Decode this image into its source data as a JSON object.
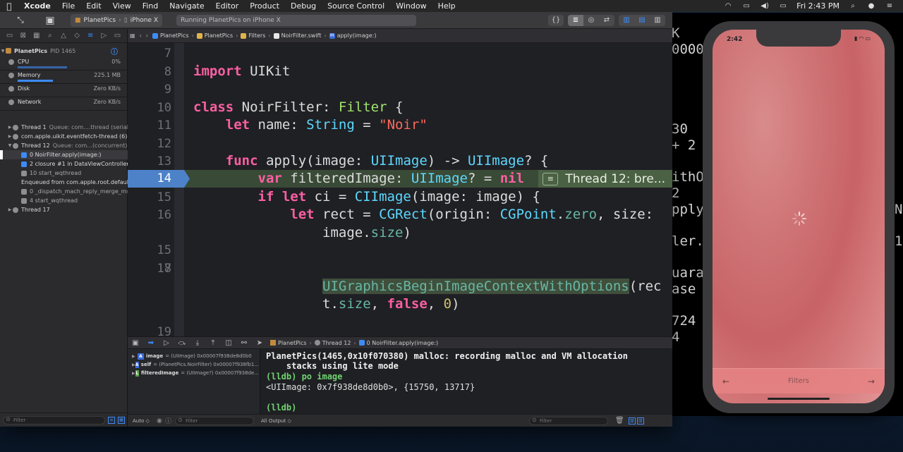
{
  "menubar": {
    "app": "Xcode",
    "items": [
      "File",
      "Edit",
      "View",
      "Find",
      "Navigate",
      "Editor",
      "Product",
      "Debug",
      "Source Control",
      "Window",
      "Help"
    ],
    "clock": "Fri 2:43 PM"
  },
  "toolbar": {
    "scheme": "PlanetPics",
    "destination": "iPhone X",
    "activity": "Running PlanetPics on iPhone X",
    "editor_mode_icon": "{}"
  },
  "navigator": {
    "process": "PlanetPics",
    "pid": "PID 1465",
    "gauges": [
      {
        "label": "CPU",
        "value": "0%"
      },
      {
        "label": "Memory",
        "value": "225.1 MB"
      },
      {
        "label": "Disk",
        "value": "Zero KB/s"
      },
      {
        "label": "Network",
        "value": "Zero KB/s"
      }
    ],
    "threads": [
      {
        "label": "Thread 1",
        "detail": "Queue: com....thread (serial)"
      },
      {
        "label": "com.apple.uikit.eventfetch-thread (6)",
        "detail": ""
      },
      {
        "label": "Thread 12",
        "detail": "Queue: com...(concurrent)"
      },
      {
        "label": "0 NoirFilter.apply(image:)",
        "detail": ""
      },
      {
        "label": "2 closure #1 in DataViewController...",
        "detail": ""
      },
      {
        "label": "10 start_wqthread",
        "detail": ""
      },
      {
        "label": "Enqueued from com.apple.root.default...",
        "detail": ""
      },
      {
        "label": "0 _dispatch_mach_reply_merge_msg",
        "detail": ""
      },
      {
        "label": "4 start_wqthread",
        "detail": ""
      },
      {
        "label": "Thread 17",
        "detail": ""
      }
    ],
    "filter_placeholder": "Filter"
  },
  "jumpbar": {
    "items": [
      "PlanetPics",
      "PlanetPics",
      "Filters",
      "NoirFilter.swift",
      "apply(image:)"
    ]
  },
  "editor": {
    "line_numbers": [
      "7",
      "8",
      "9",
      "10",
      "11",
      "12",
      "13",
      "14",
      "15",
      "16",
      "17",
      "18",
      "19"
    ],
    "current_line": "14",
    "breakpoint_label": "Thread 12: bre..."
  },
  "debugbar": {
    "crumbs": [
      "PlanetPics",
      "Thread 12",
      "0 NoirFilter.apply(image:)"
    ]
  },
  "variables": [
    {
      "badge": "A",
      "name": "image",
      "value": "= (UIImage) 0x00007f938de8d0b0"
    },
    {
      "badge": "A",
      "name": "self",
      "value": "= (PlanetPics.NoirFilter) 0x00007f938fb1..."
    },
    {
      "badge": "L",
      "name": "filteredImage",
      "value": "= (UIImage?) 0x00007f938de..."
    }
  ],
  "console": {
    "lines": [
      "PlanetPics(1465,0x10f070380) malloc: recording malloc and VM allocation",
      "    stacks using lite mode",
      "(lldb) po image",
      "<UIImage: 0x7f938de8d0b0>, {15750, 13717}",
      "",
      "(lldb)"
    ]
  },
  "bottombar": {
    "vars_scope": "Auto ◇",
    "vars_filter": "Filter",
    "output_scope": "All Output ◇",
    "console_filter": "Filter"
  },
  "terminal": {
    "lines": [
      "K",
      "0000",
      "",
      "",
      "",
      "30",
      "+ 2",
      "",
      "ithO",
      "2",
      "pply",
      "",
      "ler.",
      "",
      "uara",
      "ase",
      "",
      "724",
      "4"
    ],
    "right_lines": [
      "N",
      "1"
    ]
  },
  "phone": {
    "time": "2:42",
    "tab_title": "Filters",
    "left_arrow": "←",
    "right_arrow": "→"
  },
  "colors": {
    "keyword": "#fc5fa3",
    "type": "#5dd8ff",
    "string": "#fc6a5d",
    "number": "#d0bf69",
    "accent": "#3d8bf7",
    "breakpoint": "#4d82c9"
  }
}
